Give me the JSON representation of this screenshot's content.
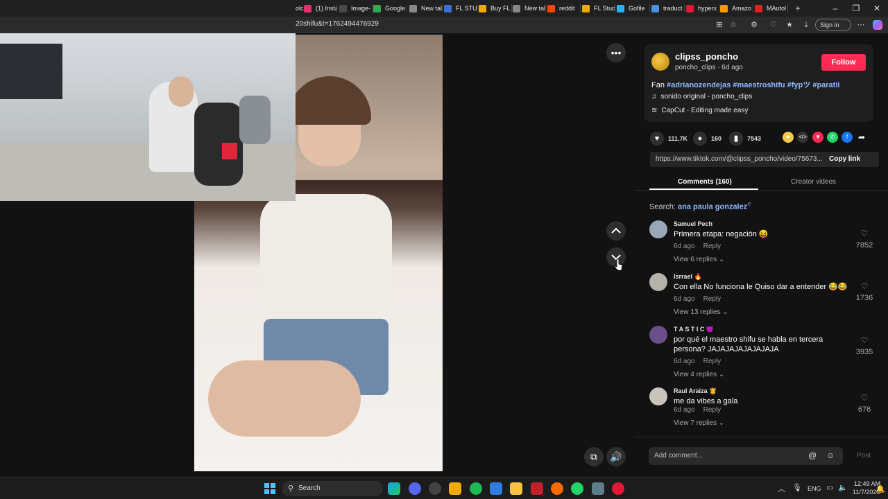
{
  "browser": {
    "tabs": [
      {
        "label": "(1) Insta",
        "color": "#e1306c"
      },
      {
        "label": "Image-",
        "color": "#4a4a4a"
      },
      {
        "label": "Google",
        "color": "#34a853"
      },
      {
        "label": "New tal",
        "color": "#888888"
      },
      {
        "label": "FL STUI",
        "color": "#3a6fd8"
      },
      {
        "label": "Buy FL",
        "color": "#f2a900"
      },
      {
        "label": "New tal",
        "color": "#888888"
      },
      {
        "label": "reddit",
        "color": "#ff4500"
      },
      {
        "label": "FL Stud",
        "color": "#f2a900"
      },
      {
        "label": "Gofile",
        "color": "#2ab0f0"
      },
      {
        "label": "traduct",
        "color": "#4a90e2"
      },
      {
        "label": "hyperx",
        "color": "#e31837"
      },
      {
        "label": "Amazo",
        "color": "#ff9900"
      },
      {
        "label": "MAutol",
        "color": "#d22"
      }
    ],
    "partial_tab_label": "olc",
    "url": "20shifu&t=1762494476929",
    "sign_in": "Sign in"
  },
  "post": {
    "author": "clipss_poncho",
    "author_sub": "poncho_clips · 6d ago",
    "follow": "Follow",
    "desc_prefix": "Fan",
    "hashtags": "#adrianozendejas #maestroshifu #fypツ #paratii",
    "sound": "sonido original - poncho_clips",
    "capcut": "CapCut · Editing made easy",
    "likes": "111.7K",
    "comments_count": "160",
    "saves": "7543",
    "link": "https://www.tiktok.com/@clipss_poncho/video/75673...",
    "copy_link": "Copy link"
  },
  "tabs": {
    "comments": "Comments (160)",
    "creator": "Creator videos"
  },
  "search": {
    "prefix": "Search:",
    "term": "ana paula gonzalez"
  },
  "comments": [
    {
      "name": "Samuel Pech",
      "text": "Primera etapa: negación 😝",
      "date": "6d ago",
      "reply": "Reply",
      "replies": "View 6 replies",
      "likes": "7852",
      "avatar": "#9aa7b8"
    },
    {
      "name": "Isrrael 🔥",
      "text": "Con ella No funciona le Quiso dar a entender 😂😂",
      "date": "6d ago",
      "reply": "Reply",
      "replies": "View 13 replies",
      "likes": "1736",
      "avatar": "#b5b2a8"
    },
    {
      "name": "T A S T I C 👿",
      "text": "por qué el maestro shifu se habla en tercera persona? JAJAJAJAJAJAJAJA",
      "date": "6d ago",
      "reply": "Reply",
      "replies": "View 4 replies",
      "likes": "3935",
      "avatar": "#6b4f8a"
    },
    {
      "name": "Raul Araiza 👸",
      "text": "me da vibes a gala",
      "date": "6d ago",
      "reply": "Reply",
      "replies": "View 7 replies",
      "likes": "676",
      "avatar": "#c9c4bb"
    }
  ],
  "comment_input": {
    "placeholder": "Add comment...",
    "post": "Post"
  },
  "taskbar": {
    "search": "Search",
    "lang": "ENG",
    "time": "12:49 AM",
    "date": "11/7/2025"
  }
}
